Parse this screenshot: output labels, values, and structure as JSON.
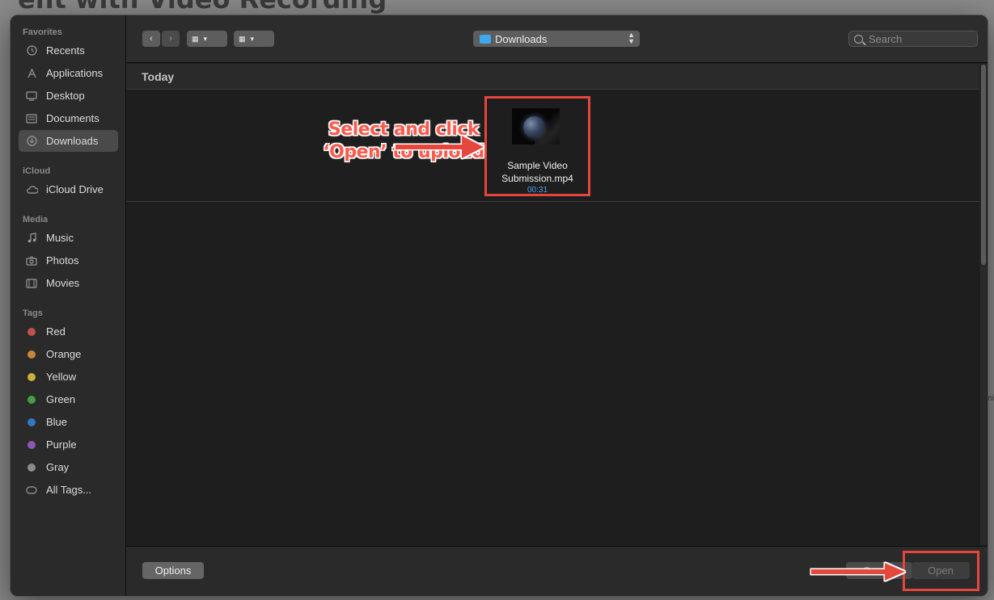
{
  "background_page": {
    "title": "ent with Video Recording",
    "edge_text": "ni"
  },
  "sidebar": {
    "sections": [
      {
        "heading": "Favorites",
        "items": [
          {
            "label": "Recents",
            "icon": "clock-icon"
          },
          {
            "label": "Applications",
            "icon": "applications-icon"
          },
          {
            "label": "Desktop",
            "icon": "desktop-icon"
          },
          {
            "label": "Documents",
            "icon": "document-icon"
          },
          {
            "label": "Downloads",
            "icon": "download-icon",
            "selected": true
          }
        ]
      },
      {
        "heading": "iCloud",
        "items": [
          {
            "label": "iCloud Drive",
            "icon": "cloud-icon"
          }
        ]
      },
      {
        "heading": "Media",
        "items": [
          {
            "label": "Music",
            "icon": "music-note-icon"
          },
          {
            "label": "Photos",
            "icon": "camera-icon"
          },
          {
            "label": "Movies",
            "icon": "film-icon"
          }
        ]
      },
      {
        "heading": "Tags",
        "items": [
          {
            "label": "Red",
            "color": "#c0504d"
          },
          {
            "label": "Orange",
            "color": "#c8853a"
          },
          {
            "label": "Yellow",
            "color": "#c9b13b"
          },
          {
            "label": "Green",
            "color": "#44a045"
          },
          {
            "label": "Blue",
            "color": "#2f79c3"
          },
          {
            "label": "Purple",
            "color": "#8e56b5"
          },
          {
            "label": "Gray",
            "color": "#8b8b8b"
          },
          {
            "label": "All Tags...",
            "icon": "tag-outline-icon"
          }
        ]
      }
    ]
  },
  "toolbar": {
    "back_glyph": "‹",
    "forward_glyph": "›",
    "icon_view_glyph": "▦",
    "group_view_glyph": "▦",
    "dropdown_glyph": "▾",
    "location": "Downloads",
    "search_placeholder": "Search"
  },
  "content": {
    "section": "Today",
    "files": [
      {
        "name": "Sample Video Submission.mp4",
        "duration": "00:31"
      }
    ]
  },
  "annotation": {
    "callout": "Select and click ‘Open’ to upload",
    "accent_color": "#e5463c"
  },
  "footer": {
    "options_label": "Options",
    "cancel_label": "Cancel",
    "open_label": "Open"
  }
}
